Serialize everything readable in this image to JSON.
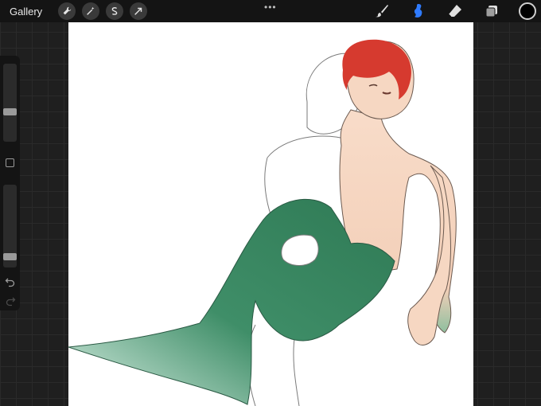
{
  "toolbar": {
    "gallery_label": "Gallery",
    "left_icons": [
      "wrench-icon",
      "magic-wand-icon",
      "selection-icon",
      "move-arrow-icon"
    ],
    "more_label": "•••",
    "right_icons": [
      "brush-icon",
      "smudge-icon",
      "eraser-icon",
      "layers-icon"
    ],
    "active_tool": "smudge-icon",
    "active_color": "#000000",
    "accent_color": "#2f7bff"
  },
  "sidebar": {
    "brush_size_level": 0.63,
    "opacity_level": 0.9
  },
  "canvas": {
    "background": "#ffffff",
    "hair_color": "#d63a2f",
    "tail_color": "#2f7a55",
    "skin_color": "#f6d7c2"
  }
}
